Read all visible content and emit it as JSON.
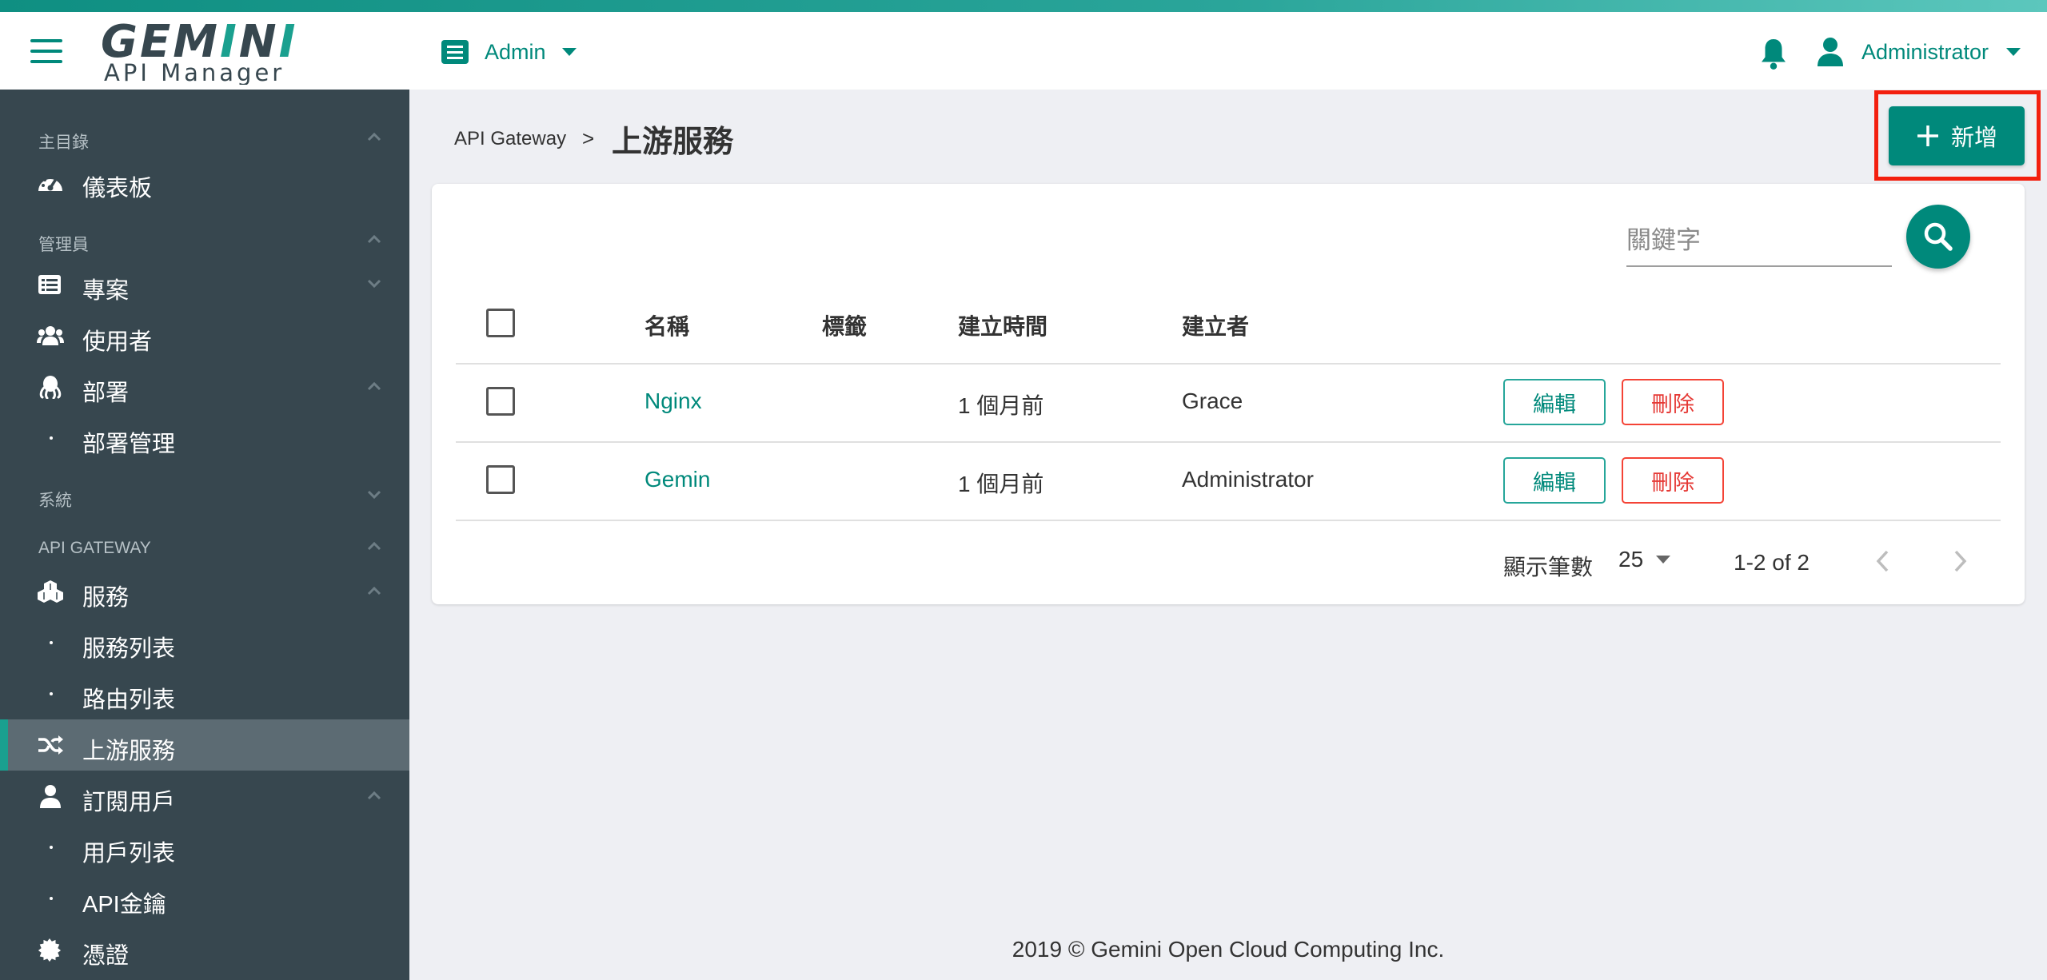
{
  "brand": {
    "logo_main": "GEMINI",
    "logo_sub": "API Manager",
    "accent": "#00897b",
    "sidebar_bg": "#37474f",
    "highlight": "#f31f0e"
  },
  "header": {
    "project_label": "Admin",
    "user_label": "Administrator"
  },
  "sidebar": {
    "sections": {
      "main": "主目錄",
      "manager": "管理員",
      "system": "系統",
      "gateway": "API GATEWAY"
    },
    "items": {
      "dashboard": "儀表板",
      "projects": "專案",
      "users": "使用者",
      "deploy": "部署",
      "deploy_manage": "部署管理",
      "services": "服務",
      "service_list": "服務列表",
      "route_list": "路由列表",
      "upstream": "上游服務",
      "subscribers": "訂閱用戶",
      "subscriber_list": "用戶列表",
      "api_keys": "API金鑰",
      "certificates": "憑證"
    }
  },
  "breadcrumb": {
    "parent": "API Gateway",
    "separator": ">",
    "current": "上游服務"
  },
  "actions": {
    "add_label": "新增"
  },
  "search": {
    "placeholder": "關鍵字"
  },
  "table": {
    "headers": {
      "name": "名稱",
      "tags": "標籤",
      "created": "建立時間",
      "creator": "建立者"
    },
    "rows": [
      {
        "name": "Nginx",
        "tags": "",
        "created": "1 個月前",
        "creator": "Grace",
        "edit": "編輯",
        "delete": "刪除"
      },
      {
        "name": "Gemin",
        "tags": "",
        "created": "1 個月前",
        "creator": "Administrator",
        "edit": "編輯",
        "delete": "刪除"
      }
    ]
  },
  "pagination": {
    "rows_label": "顯示筆數",
    "rows_value": "25",
    "range": "1-2 of 2"
  },
  "footer": {
    "text": "2019 © Gemini Open Cloud Computing Inc."
  }
}
